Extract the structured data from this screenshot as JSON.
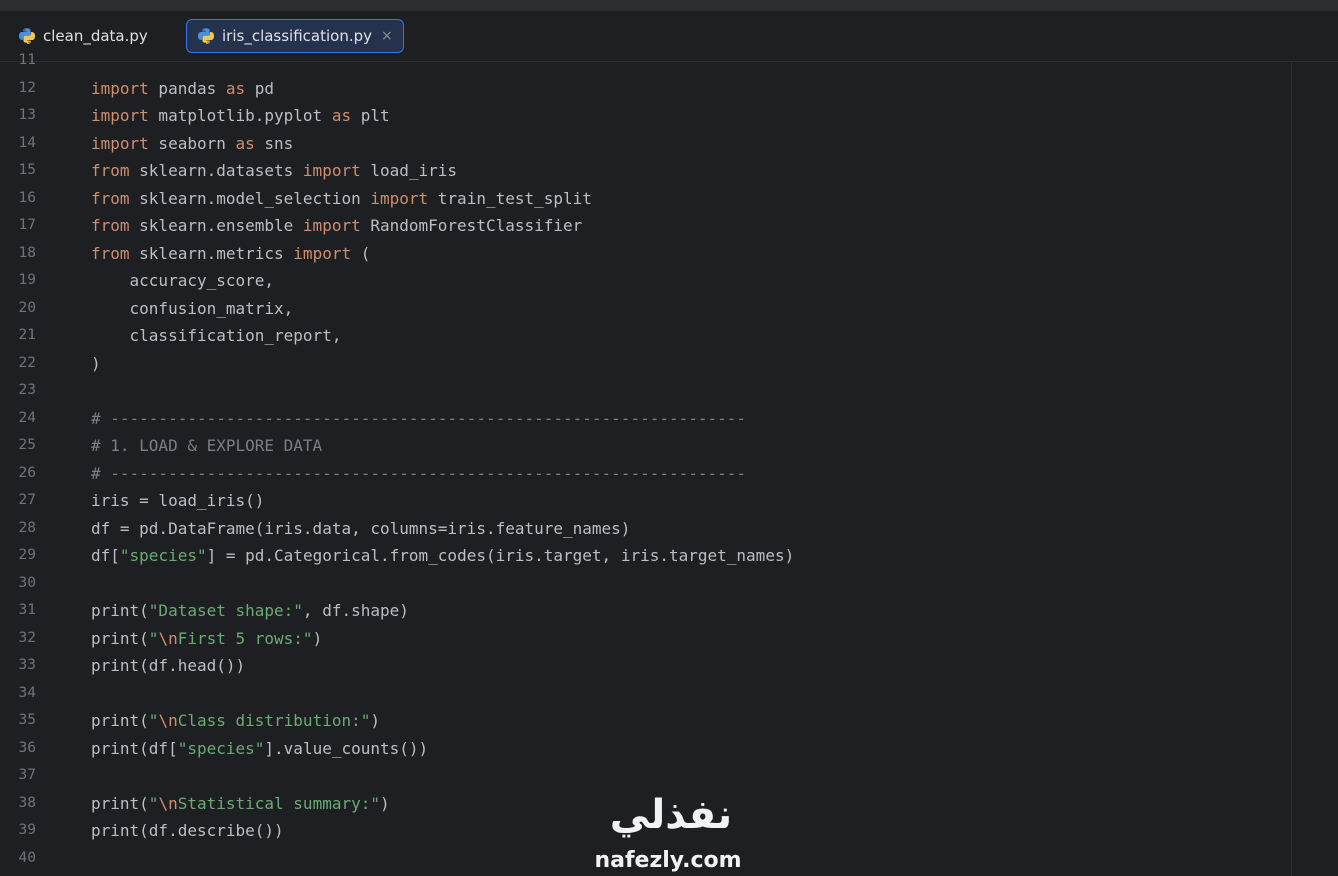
{
  "tabs": [
    {
      "label": "clean_data.py",
      "active": false,
      "icon": "python-icon"
    },
    {
      "label": "iris_classification.py",
      "active": true,
      "icon": "python-icon",
      "close": "×"
    }
  ],
  "colors": {
    "background": "#1e1f22",
    "active_tab_border": "#3574f0",
    "keyword": "#cf8e6d",
    "string": "#6aab73",
    "comment": "#7a7e85",
    "text": "#bcbec4",
    "line_number": "#6f737a"
  },
  "editor": {
    "lines": [
      {
        "n": "11",
        "tokens": []
      },
      {
        "n": "12",
        "tokens": [
          [
            "kw",
            "import"
          ],
          [
            "t",
            " pandas "
          ],
          [
            "kw",
            "as"
          ],
          [
            "t",
            " pd"
          ]
        ]
      },
      {
        "n": "13",
        "tokens": [
          [
            "kw",
            "import"
          ],
          [
            "t",
            " matplotlib.pyplot "
          ],
          [
            "kw",
            "as"
          ],
          [
            "t",
            " plt"
          ]
        ]
      },
      {
        "n": "14",
        "tokens": [
          [
            "kw",
            "import"
          ],
          [
            "t",
            " seaborn "
          ],
          [
            "kw",
            "as"
          ],
          [
            "t",
            " sns"
          ]
        ]
      },
      {
        "n": "15",
        "tokens": [
          [
            "kw",
            "from"
          ],
          [
            "t",
            " sklearn.datasets "
          ],
          [
            "kw",
            "import"
          ],
          [
            "t",
            " load_iris"
          ]
        ]
      },
      {
        "n": "16",
        "tokens": [
          [
            "kw",
            "from"
          ],
          [
            "t",
            " sklearn.model_selection "
          ],
          [
            "kw",
            "import"
          ],
          [
            "t",
            " train_test_split"
          ]
        ]
      },
      {
        "n": "17",
        "tokens": [
          [
            "kw",
            "from"
          ],
          [
            "t",
            " sklearn.ensemble "
          ],
          [
            "kw",
            "import"
          ],
          [
            "t",
            " RandomForestClassifier"
          ]
        ]
      },
      {
        "n": "18",
        "tokens": [
          [
            "kw",
            "from"
          ],
          [
            "t",
            " sklearn.metrics "
          ],
          [
            "kw",
            "import"
          ],
          [
            "t",
            " ("
          ]
        ]
      },
      {
        "n": "19",
        "tokens": [
          [
            "t",
            "    accuracy_score,"
          ]
        ]
      },
      {
        "n": "20",
        "tokens": [
          [
            "t",
            "    confusion_matrix,"
          ]
        ]
      },
      {
        "n": "21",
        "tokens": [
          [
            "t",
            "    classification_report,"
          ]
        ]
      },
      {
        "n": "22",
        "tokens": [
          [
            "t",
            ")"
          ]
        ]
      },
      {
        "n": "23",
        "tokens": []
      },
      {
        "n": "24",
        "tokens": [
          [
            "cm",
            "# ------------------------------------------------------------------"
          ]
        ]
      },
      {
        "n": "25",
        "tokens": [
          [
            "cm",
            "# 1. LOAD & EXPLORE DATA"
          ]
        ]
      },
      {
        "n": "26",
        "tokens": [
          [
            "cm",
            "# ------------------------------------------------------------------"
          ]
        ]
      },
      {
        "n": "27",
        "tokens": [
          [
            "t",
            "iris = load_iris()"
          ]
        ]
      },
      {
        "n": "28",
        "tokens": [
          [
            "t",
            "df = pd.DataFrame(iris.data, columns=iris.feature_names)"
          ]
        ]
      },
      {
        "n": "29",
        "tokens": [
          [
            "t",
            "df["
          ],
          [
            "str",
            "\"species\""
          ],
          [
            "t",
            "] = pd.Categorical.from_codes(iris.target, iris.target_names)"
          ]
        ]
      },
      {
        "n": "30",
        "tokens": []
      },
      {
        "n": "31",
        "tokens": [
          [
            "t",
            "print("
          ],
          [
            "str",
            "\"Dataset shape:\""
          ],
          [
            "t",
            ", df.shape)"
          ]
        ]
      },
      {
        "n": "32",
        "tokens": [
          [
            "t",
            "print("
          ],
          [
            "str",
            "\""
          ],
          [
            "esc",
            "\\n"
          ],
          [
            "str",
            "First 5 rows:\""
          ],
          [
            "t",
            ")"
          ]
        ]
      },
      {
        "n": "33",
        "tokens": [
          [
            "t",
            "print(df.head())"
          ]
        ]
      },
      {
        "n": "34",
        "tokens": []
      },
      {
        "n": "35",
        "tokens": [
          [
            "t",
            "print("
          ],
          [
            "str",
            "\""
          ],
          [
            "esc",
            "\\n"
          ],
          [
            "str",
            "Class distribution:\""
          ],
          [
            "t",
            ")"
          ]
        ]
      },
      {
        "n": "36",
        "tokens": [
          [
            "t",
            "print(df["
          ],
          [
            "str",
            "\"species\""
          ],
          [
            "t",
            "].value_counts())"
          ]
        ]
      },
      {
        "n": "37",
        "tokens": []
      },
      {
        "n": "38",
        "tokens": [
          [
            "t",
            "print("
          ],
          [
            "str",
            "\""
          ],
          [
            "esc",
            "\\n"
          ],
          [
            "str",
            "Statistical summary:\""
          ],
          [
            "t",
            ")"
          ]
        ]
      },
      {
        "n": "39",
        "tokens": [
          [
            "t",
            "print(df.describe())"
          ]
        ]
      },
      {
        "n": "40",
        "tokens": []
      }
    ]
  },
  "watermark": {
    "arabic": "نفذلي",
    "latin": "nafezly.com"
  }
}
